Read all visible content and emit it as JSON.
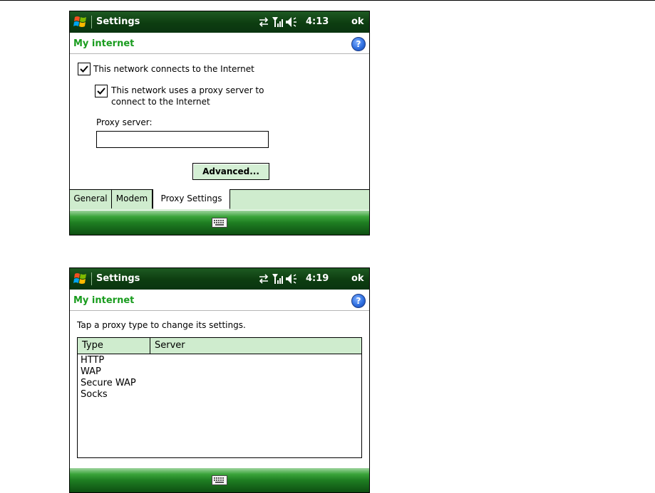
{
  "screens": [
    {
      "titlebar": {
        "title": "Settings",
        "time": "4:13",
        "ok_label": "ok"
      },
      "header": {
        "title": "My internet",
        "help": "?"
      },
      "checkbox_internet": {
        "label": "This network connects to the Internet",
        "checked": true
      },
      "checkbox_proxy": {
        "label_line1": "This network uses a proxy server to",
        "label_line2": "connect to the Internet",
        "checked": true
      },
      "proxy_field": {
        "label": "Proxy server:",
        "value": ""
      },
      "advanced_button": "Advanced...",
      "tabs": [
        "General",
        "Modem",
        "Proxy Settings"
      ],
      "active_tab": "Proxy Settings"
    },
    {
      "titlebar": {
        "title": "Settings",
        "time": "4:19",
        "ok_label": "ok"
      },
      "header": {
        "title": "My internet",
        "help": "?"
      },
      "instruction": "Tap a proxy type to change its settings.",
      "list": {
        "columns": [
          "Type",
          "Server"
        ],
        "rows": [
          "HTTP",
          "WAP",
          "Secure WAP",
          "Socks"
        ]
      }
    }
  ],
  "colors": {
    "accent_green": "#199c1e",
    "titlebar": "#0d3d10",
    "tab_bg": "#cfecce"
  },
  "icons": [
    "windows-logo-icon",
    "connection-arrows-icon",
    "signal-strength-icon",
    "speaker-icon",
    "help-icon",
    "checkmark-icon",
    "keyboard-icon"
  ]
}
